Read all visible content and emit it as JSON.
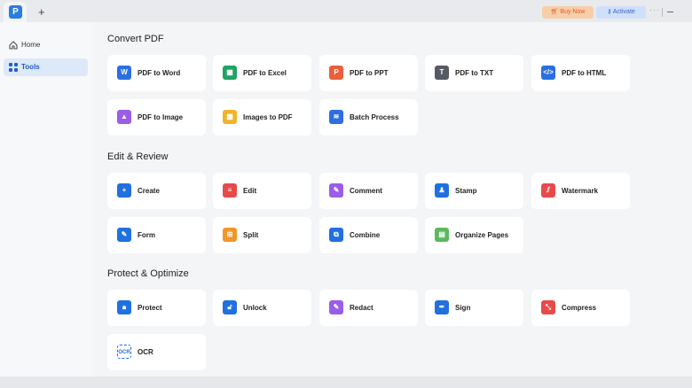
{
  "titlebar": {
    "logo": "P",
    "new_tab": "+",
    "buy_now": "Buy Now",
    "activate": "Activate",
    "more": "···"
  },
  "sidebar": {
    "items": [
      {
        "label": "Home",
        "icon": "home-icon"
      },
      {
        "label": "Tools",
        "icon": "grid-icon",
        "active": true
      }
    ]
  },
  "sections": [
    {
      "title": "Convert PDF",
      "tools": [
        {
          "label": "PDF to Word",
          "glyph": "W",
          "color": "#2b6fe0"
        },
        {
          "label": "PDF to Excel",
          "glyph": "▦",
          "color": "#1fa463"
        },
        {
          "label": "PDF to PPT",
          "glyph": "P",
          "color": "#e8603c"
        },
        {
          "label": "PDF to TXT",
          "glyph": "T",
          "color": "#555a63"
        },
        {
          "label": "PDF to HTML",
          "glyph": "</>",
          "color": "#2b6fe0"
        },
        {
          "label": "PDF to Image",
          "glyph": "▲",
          "color": "#9b5de5"
        },
        {
          "label": "Images to PDF",
          "glyph": "▩",
          "color": "#f0b429"
        },
        {
          "label": "Batch Process",
          "glyph": "≋",
          "color": "#2b6fe0"
        }
      ]
    },
    {
      "title": "Edit & Review",
      "tools": [
        {
          "label": "Create",
          "glyph": "+",
          "color": "#2070e0"
        },
        {
          "label": "Edit",
          "glyph": "≡",
          "color": "#e84a4a"
        },
        {
          "label": "Comment",
          "glyph": "✎",
          "color": "#9b5de5"
        },
        {
          "label": "Stamp",
          "glyph": "♟",
          "color": "#2070e0"
        },
        {
          "label": "Watermark",
          "glyph": "⫽",
          "color": "#e84a4a"
        },
        {
          "label": "Form",
          "glyph": "✎",
          "color": "#2070e0"
        },
        {
          "label": "Split",
          "glyph": "⊞",
          "color": "#f0962a"
        },
        {
          "label": "Combine",
          "glyph": "⧉",
          "color": "#2070e0"
        },
        {
          "label": "Organize Pages",
          "glyph": "▤",
          "color": "#5cb85c"
        }
      ]
    },
    {
      "title": "Protect & Optimize",
      "tools": [
        {
          "label": "Protect",
          "glyph": "🔒︎",
          "color": "#2070e0"
        },
        {
          "label": "Unlock",
          "glyph": "🔓︎",
          "color": "#2070e0"
        },
        {
          "label": "Redact",
          "glyph": "✎",
          "color": "#9b5de5"
        },
        {
          "label": "Sign",
          "glyph": "✒",
          "color": "#2070e0"
        },
        {
          "label": "Compress",
          "glyph": "⤡",
          "color": "#e84a4a"
        },
        {
          "label": "OCR",
          "glyph": "OCR",
          "color": "#2070e0"
        }
      ]
    }
  ]
}
